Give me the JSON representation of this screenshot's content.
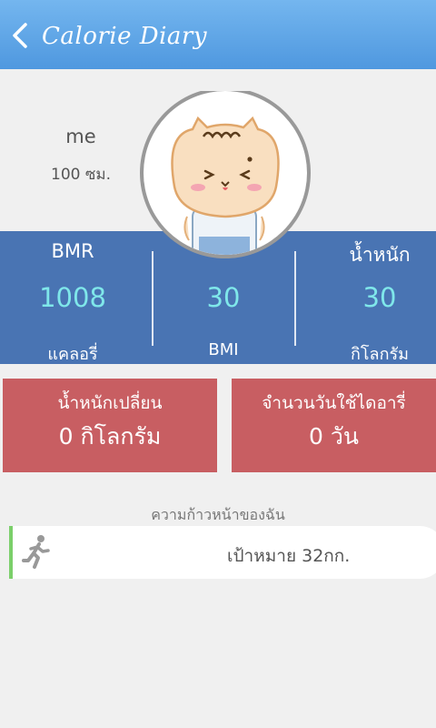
{
  "header": {
    "title": "Calorie Diary"
  },
  "profile": {
    "name": "me",
    "height": "100 ซม."
  },
  "stats": {
    "bmr": {
      "label": "BMR",
      "value": "1008",
      "unit": "แคลอรี่"
    },
    "bmi": {
      "value": "30",
      "label": "BMI"
    },
    "weight": {
      "label": "น้ำหนัก",
      "value": "30",
      "unit": "กิโลกรัม"
    }
  },
  "cards": {
    "weight_change": {
      "title": "น้ำหนักเปลี่ยน",
      "value": "0 กิโลกรัม"
    },
    "days_used": {
      "title": "จำนวนวันใช้ไดอารี่",
      "value": "0 วัน"
    }
  },
  "progress": {
    "heading": "ความก้าวหน้าของฉัน",
    "goal": "เป้าหมาย 32กก."
  },
  "colors": {
    "appbar": "#5aa2e6",
    "stats_bg": "#4974b3",
    "stat_value": "#7fe7ea",
    "card_bg": "#c85e62",
    "progress_accent": "#7bcf6a"
  },
  "icons": {
    "back": "chevron-left-icon",
    "avatar": "cat-avatar",
    "runner": "runner-icon"
  }
}
